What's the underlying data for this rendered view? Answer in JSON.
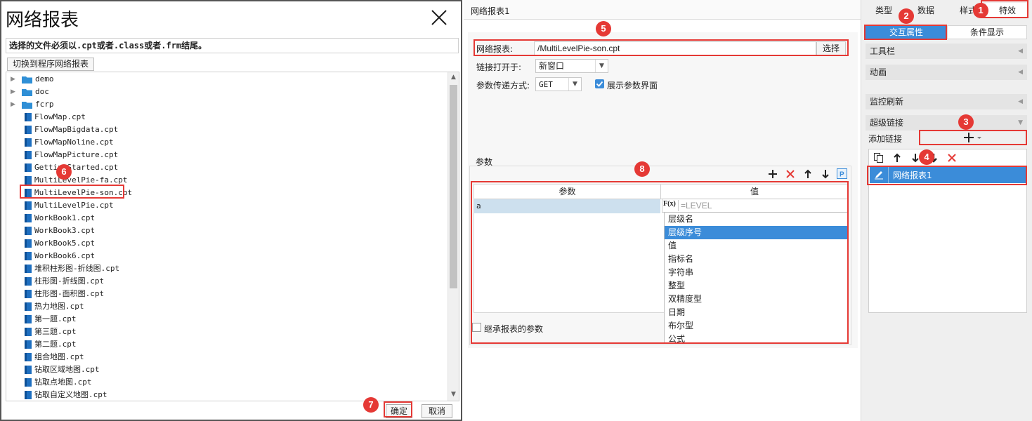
{
  "dialog": {
    "title": "网络报表",
    "hint": "选择的文件必须以.cpt或者.class或者.frm结尾。",
    "switch_label": "切换到程序网络报表",
    "folders": [
      "demo",
      "doc",
      "fcrp"
    ],
    "files": [
      "FlowMap.cpt",
      "FlowMapBigdata.cpt",
      "FlowMapNoline.cpt",
      "FlowMapPicture.cpt",
      "GettingStarted.cpt",
      "MultiLevelPie-fa.cpt",
      "MultiLevelPie-son.cpt",
      "MultiLevelPie.cpt",
      "WorkBook1.cpt",
      "WorkBook3.cpt",
      "WorkBook5.cpt",
      "WorkBook6.cpt",
      "堆积柱形图-折线图.cpt",
      "柱形图-折线图.cpt",
      "柱形图-面积图.cpt",
      "热力地图.cpt",
      "第一题.cpt",
      "第三题.cpt",
      "第二题.cpt",
      "组合地图.cpt",
      "钻取区域地图.cpt",
      "钻取点地图.cpt",
      "钻取自定义地图.cpt"
    ],
    "ok_label": "确定",
    "cancel_label": "取消"
  },
  "middle": {
    "header_title": "网络报表1",
    "report_label": "网络报表:",
    "report_value": "/MultiLevelPie-son.cpt",
    "choose_label": "选择",
    "open_label": "链接打开于:",
    "open_value": "新窗口",
    "method_label": "参数传递方式:",
    "method_value": "GET",
    "show_param_label": "展示参数界面",
    "params_title": "参数",
    "col_param": "参数",
    "col_value": "值",
    "row_param": "a",
    "formula_prefix": "F(x)",
    "formula_placeholder": "=LEVEL",
    "dropdown_items": [
      "层级名",
      "层级序号",
      "值",
      "指标名",
      "字符串",
      "整型",
      "双精度型",
      "日期",
      "布尔型",
      "公式"
    ],
    "dropdown_selected": "层级序号",
    "inherit_label": "继承报表的参数"
  },
  "right": {
    "tabs": [
      "类型",
      "数据",
      "样式",
      "特效"
    ],
    "subtabs": [
      "交互属性",
      "条件显示"
    ],
    "sections": [
      "工具栏",
      "动画",
      "监控刷新",
      "超级链接"
    ],
    "add_link_label": "添加链接",
    "link_item": "网络报表1"
  },
  "badges": [
    "1",
    "2",
    "3",
    "4",
    "5",
    "6",
    "7",
    "8"
  ],
  "colors": {
    "accent": "#3b8cd9",
    "annotation": "#e53935"
  }
}
